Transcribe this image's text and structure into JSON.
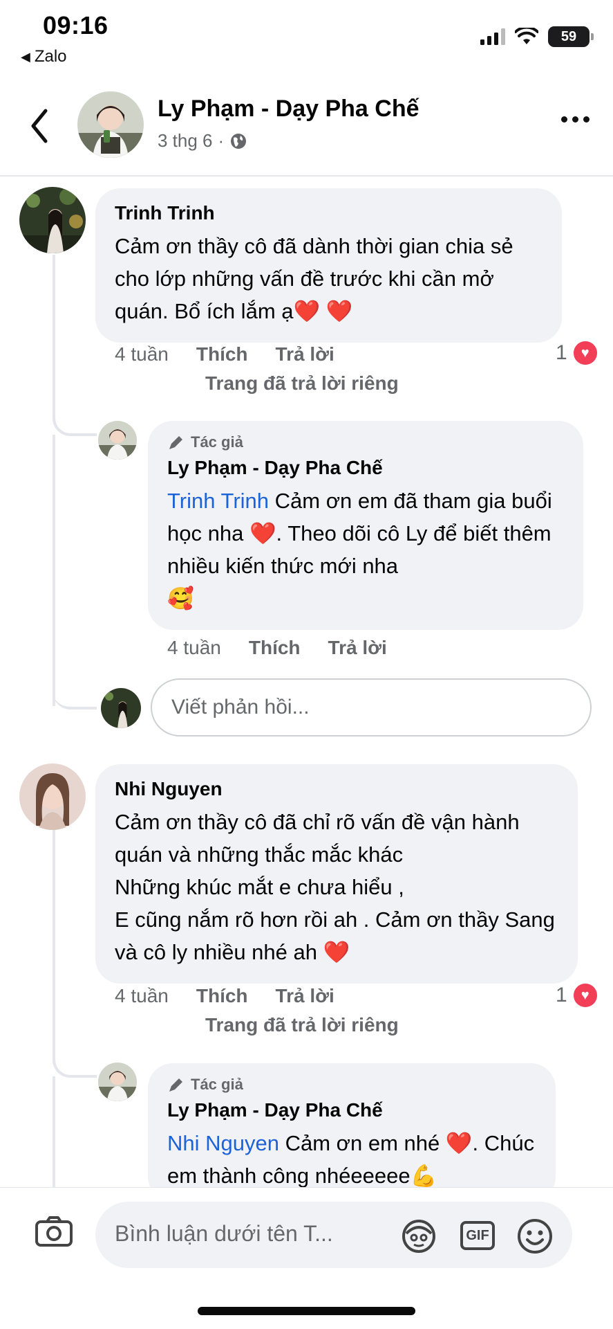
{
  "status_bar": {
    "time": "09:16",
    "back_app": "Zalo",
    "battery": "59"
  },
  "header": {
    "name": "Ly Phạm - Dạy Pha Chế",
    "date": "3 thg 6",
    "separator": "·"
  },
  "comments": [
    {
      "author": "Trinh Trinh",
      "text": "Cảm ơn thầy cô đã dành thời gian chia sẻ cho lớp những vấn đề trước khi cần mở quán. Bổ ích lắm ạ",
      "hearts": "❤️ ❤️",
      "time": "4 tuần",
      "like": "Thích",
      "reply": "Trả lời",
      "private_reply": "Trang đã trả lời riêng",
      "reaction_count": "1",
      "replies": [
        {
          "badge": "Tác giả",
          "author": "Ly Phạm - Dạy Pha Chế",
          "tag": "Trinh Trinh",
          "text_a": " Cảm ơn em đã tham gia buổi học nha ",
          "emoji_a": "❤️",
          "text_b": ". Theo dõi cô Ly để biết thêm nhiều kiến thức mới nha",
          "emoji_b": "🥰",
          "time": "4 tuần",
          "like": "Thích",
          "reply": "Trả lời"
        }
      ],
      "reply_placeholder": "Viết phản hồi..."
    },
    {
      "author": "Nhi Nguyen",
      "line1": "Cảm ơn thầy cô đã chỉ rõ vấn đề vận hành quán và những thắc mắc khác",
      "line2": "Những khúc mắt e chưa hiểu ,",
      "line3": "E cũng nắm rõ hơn rồi ah . Cảm ơn  thầy Sang và cô ly nhiều nhé ah",
      "heart": "❤️",
      "time": "4 tuần",
      "like": "Thích",
      "reply": "Trả lời",
      "private_reply": "Trang đã trả lời riêng",
      "reaction_count": "1",
      "replies": [
        {
          "badge": "Tác giả",
          "author": "Ly Phạm - Dạy Pha Chế",
          "tag": "Nhi Nguyen",
          "text_a": " Cảm ơn em nhé ",
          "emoji_a": "❤️",
          "text_b": ". Chúc em thành công nhéeeeee",
          "emoji_b": "💪"
        }
      ]
    }
  ],
  "composer": {
    "placeholder": "Bình luận dưới tên T...",
    "gif_label": "GIF"
  }
}
